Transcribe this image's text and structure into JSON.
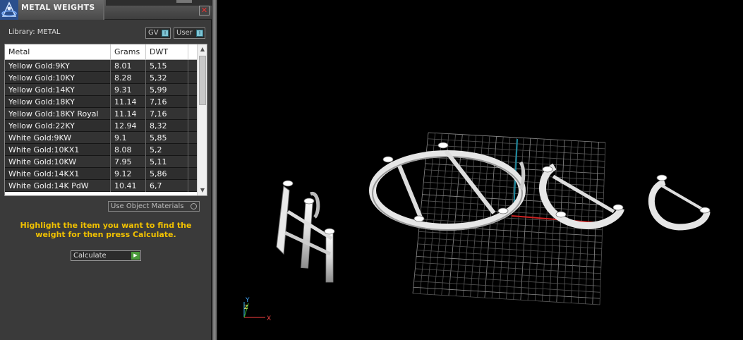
{
  "panel": {
    "title": "METAL WEIGHTS",
    "close_glyph": "✕",
    "library_label": "Library: METAL",
    "toggles": [
      {
        "label": "GV",
        "knob": "I"
      },
      {
        "label": "User",
        "knob": "I"
      }
    ],
    "table": {
      "headers": [
        "Metal",
        "Grams",
        "DWT"
      ],
      "rows": [
        {
          "metal": "Yellow Gold:9KY",
          "grams": "8.01",
          "dwt": "5,15"
        },
        {
          "metal": "Yellow Gold:10KY",
          "grams": "8.28",
          "dwt": "5,32"
        },
        {
          "metal": "Yellow Gold:14KY",
          "grams": "9.31",
          "dwt": "5,99"
        },
        {
          "metal": "Yellow Gold:18KY",
          "grams": "11.14",
          "dwt": "7,16"
        },
        {
          "metal": "Yellow Gold:18KY Royal",
          "grams": "11.14",
          "dwt": "7,16"
        },
        {
          "metal": "Yellow Gold:22KY",
          "grams": "12.94",
          "dwt": "8,32"
        },
        {
          "metal": "White Gold:9KW",
          "grams": "9.1",
          "dwt": "5,85"
        },
        {
          "metal": "White Gold:10KX1",
          "grams": "8.08",
          "dwt": "5,2"
        },
        {
          "metal": "White Gold:10KW",
          "grams": "7.95",
          "dwt": "5,11"
        },
        {
          "metal": "White Gold:14KX1",
          "grams": "9.12",
          "dwt": "5,86"
        },
        {
          "metal": "White Gold:14K PdW",
          "grams": "10.41",
          "dwt": "6,7"
        }
      ]
    },
    "use_object_materials": "Use Object Materials",
    "instructions": "Highlight the item you want to find the weight for then press Calculate.",
    "calculate_label": "Calculate",
    "instructions_color": "#f2c200"
  },
  "viewport": {
    "axis_labels": {
      "y": "Y",
      "z": "Z",
      "x": "X"
    },
    "icons": [
      "app-logo-icon",
      "close-icon",
      "calculate-go-icon"
    ]
  }
}
